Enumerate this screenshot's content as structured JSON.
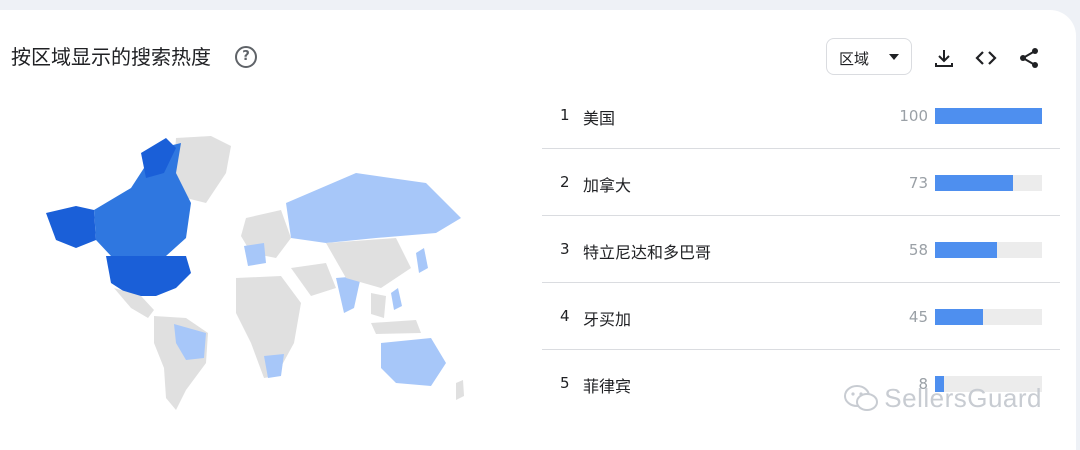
{
  "header": {
    "title": "按区域显示的搜索热度",
    "help_glyph": "?",
    "region_dropdown": "区域"
  },
  "icons": [
    "help-icon",
    "chevron-down-icon",
    "download-icon",
    "embed-code-icon",
    "share-icon"
  ],
  "colors": {
    "bar": "#4e8fef",
    "track": "#ececec",
    "map_dark": "#1a5fd8",
    "map_mid": "#2f77e0",
    "map_light": "#a7c7f9",
    "map_none": "#e0e0e0"
  },
  "regions": [
    {
      "rank": "1",
      "name": "美国",
      "value": 100
    },
    {
      "rank": "2",
      "name": "加拿大",
      "value": 73
    },
    {
      "rank": "3",
      "name": "特立尼达和多巴哥",
      "value": 58
    },
    {
      "rank": "4",
      "name": "牙买加",
      "value": 45
    },
    {
      "rank": "5",
      "name": "菲律宾",
      "value": 8
    }
  ],
  "watermark": "SellersGuard"
}
